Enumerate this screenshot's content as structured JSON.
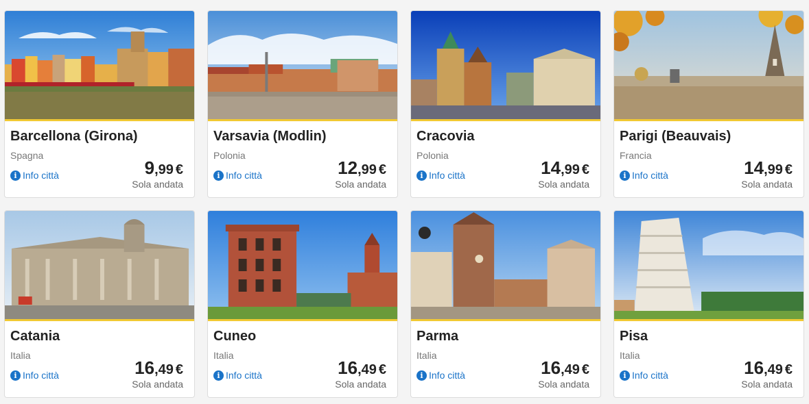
{
  "cards": [
    {
      "city": "Barcellona (Girona)",
      "country": "Spagna",
      "info": "Info città",
      "price_int": "9",
      "price_dec": ",99",
      "currency": "€",
      "trip": "Sola andata",
      "image": "girona-colorful-riverside-houses"
    },
    {
      "city": "Varsavia (Modlin)",
      "country": "Polonia",
      "info": "Info città",
      "price_int": "12",
      "price_dec": ",99",
      "currency": "€",
      "trip": "Sola andata",
      "image": "warsaw-castle-square"
    },
    {
      "city": "Cracovia",
      "country": "Polonia",
      "info": "Info città",
      "price_int": "14",
      "price_dec": ",99",
      "currency": "€",
      "trip": "Sola andata",
      "image": "krakow-main-square"
    },
    {
      "city": "Parigi (Beauvais)",
      "country": "Francia",
      "info": "Info città",
      "price_int": "14",
      "price_dec": ",99",
      "currency": "€",
      "trip": "Sola andata",
      "image": "paris-eiffel-tower"
    },
    {
      "city": "Catania",
      "country": "Italia",
      "info": "Info città",
      "price_int": "16",
      "price_dec": ",49",
      "currency": "€",
      "trip": "Sola andata",
      "image": "catania-cathedral"
    },
    {
      "city": "Cuneo",
      "country": "Italia",
      "info": "Info città",
      "price_int": "16",
      "price_dec": ",49",
      "currency": "€",
      "trip": "Sola andata",
      "image": "cuneo-brick-tower"
    },
    {
      "city": "Parma",
      "country": "Italia",
      "info": "Info città",
      "price_int": "16",
      "price_dec": ",49",
      "currency": "€",
      "trip": "Sola andata",
      "image": "parma-cathedral-baptistery"
    },
    {
      "city": "Pisa",
      "country": "Italia",
      "info": "Info città",
      "price_int": "16",
      "price_dec": ",49",
      "currency": "€",
      "trip": "Sola andata",
      "image": "pisa-leaning-tower"
    }
  ],
  "colors": {
    "accent": "#f1c933",
    "link": "#1a73c8"
  }
}
